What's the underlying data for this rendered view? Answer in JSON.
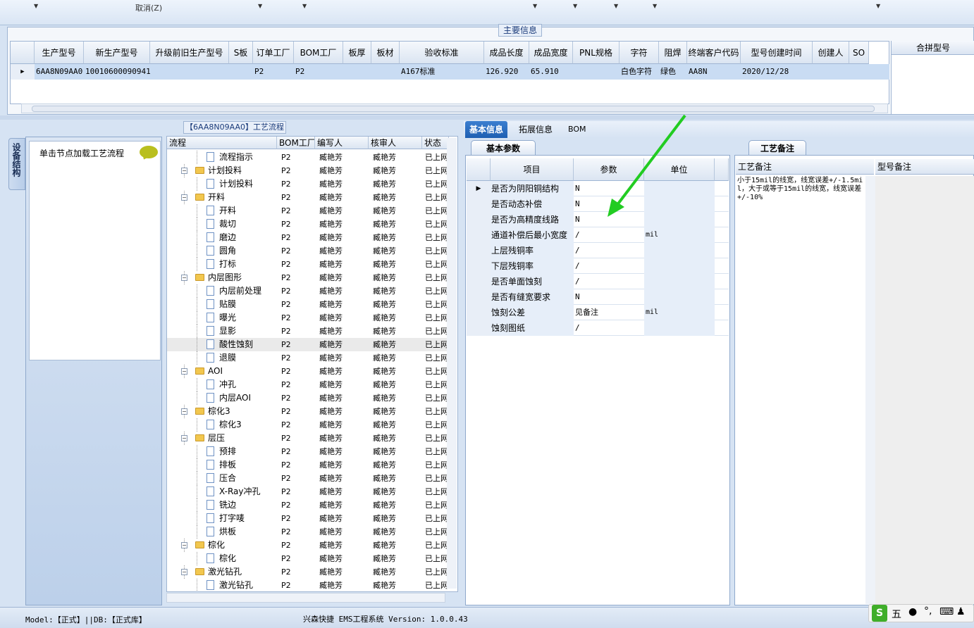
{
  "toolbar": {
    "cancel_label": "取消(Z)"
  },
  "main_info": {
    "title": "主要信息",
    "columns": [
      "生产型号",
      "新生产型号",
      "升级前旧生产型号",
      "S板",
      "订单工厂",
      "BOM工厂",
      "板厚",
      "板材",
      "验收标准",
      "成品长度",
      "成品宽度",
      "PNL规格",
      "字符",
      "阻焊",
      "终端客户代码",
      "型号创建时间",
      "创建人",
      "SO"
    ],
    "row": [
      "6AA8N09AA0",
      "10010600090941",
      "",
      "",
      "P2",
      "P2",
      "",
      "",
      "A167标准",
      "126.920",
      "65.910",
      "",
      "白色字符",
      "绿色",
      "AA8N",
      "2020/12/28",
      "",
      ""
    ],
    "merge_header": "合拼型号"
  },
  "left": {
    "vtab_label": "设备结构",
    "node_hint": "单击节点加载工艺流程"
  },
  "process": {
    "title": "【6AA8N09AA0】工艺流程",
    "columns": [
      "流程",
      "BOM工厂",
      "编写人",
      "核审人",
      "状态"
    ],
    "rows": [
      {
        "name": "流程指示",
        "type": "doc",
        "factory": "P2",
        "writer": "臧艳芳",
        "reviewer": "臧艳芳",
        "status": "已上网"
      },
      {
        "name": "计划投料",
        "type": "folder",
        "factory": "P2",
        "writer": "臧艳芳",
        "reviewer": "臧艳芳",
        "status": "已上网"
      },
      {
        "name": "计划投料",
        "type": "doc",
        "factory": "P2",
        "writer": "臧艳芳",
        "reviewer": "臧艳芳",
        "status": "已上网"
      },
      {
        "name": "开料",
        "type": "folder",
        "factory": "P2",
        "writer": "臧艳芳",
        "reviewer": "臧艳芳",
        "status": "已上网"
      },
      {
        "name": "开料",
        "type": "doc",
        "factory": "P2",
        "writer": "臧艳芳",
        "reviewer": "臧艳芳",
        "status": "已上网"
      },
      {
        "name": "裁切",
        "type": "doc",
        "factory": "P2",
        "writer": "臧艳芳",
        "reviewer": "臧艳芳",
        "status": "已上网"
      },
      {
        "name": "磨边",
        "type": "doc",
        "factory": "P2",
        "writer": "臧艳芳",
        "reviewer": "臧艳芳",
        "status": "已上网"
      },
      {
        "name": "圆角",
        "type": "doc",
        "factory": "P2",
        "writer": "臧艳芳",
        "reviewer": "臧艳芳",
        "status": "已上网"
      },
      {
        "name": "打标",
        "type": "doc",
        "factory": "P2",
        "writer": "臧艳芳",
        "reviewer": "臧艳芳",
        "status": "已上网"
      },
      {
        "name": "内层图形",
        "type": "folder",
        "factory": "P2",
        "writer": "臧艳芳",
        "reviewer": "臧艳芳",
        "status": "已上网"
      },
      {
        "name": "内层前处理",
        "type": "doc",
        "factory": "P2",
        "writer": "臧艳芳",
        "reviewer": "臧艳芳",
        "status": "已上网"
      },
      {
        "name": "贴膜",
        "type": "doc",
        "factory": "P2",
        "writer": "臧艳芳",
        "reviewer": "臧艳芳",
        "status": "已上网"
      },
      {
        "name": "曝光",
        "type": "doc",
        "factory": "P2",
        "writer": "臧艳芳",
        "reviewer": "臧艳芳",
        "status": "已上网"
      },
      {
        "name": "显影",
        "type": "doc",
        "factory": "P2",
        "writer": "臧艳芳",
        "reviewer": "臧艳芳",
        "status": "已上网"
      },
      {
        "name": "酸性蚀刻",
        "type": "doc",
        "factory": "P2",
        "writer": "臧艳芳",
        "reviewer": "臧艳芳",
        "status": "已上网",
        "selected": true
      },
      {
        "name": "退膜",
        "type": "doc",
        "factory": "P2",
        "writer": "臧艳芳",
        "reviewer": "臧艳芳",
        "status": "已上网"
      },
      {
        "name": "AOI",
        "type": "folder",
        "factory": "P2",
        "writer": "臧艳芳",
        "reviewer": "臧艳芳",
        "status": "已上网"
      },
      {
        "name": "冲孔",
        "type": "doc",
        "factory": "P2",
        "writer": "臧艳芳",
        "reviewer": "臧艳芳",
        "status": "已上网"
      },
      {
        "name": "内层AOI",
        "type": "doc",
        "factory": "P2",
        "writer": "臧艳芳",
        "reviewer": "臧艳芳",
        "status": "已上网"
      },
      {
        "name": "棕化3",
        "type": "folder",
        "factory": "P2",
        "writer": "臧艳芳",
        "reviewer": "臧艳芳",
        "status": "已上网"
      },
      {
        "name": "棕化3",
        "type": "doc",
        "factory": "P2",
        "writer": "臧艳芳",
        "reviewer": "臧艳芳",
        "status": "已上网"
      },
      {
        "name": "层压",
        "type": "folder",
        "factory": "P2",
        "writer": "臧艳芳",
        "reviewer": "臧艳芳",
        "status": "已上网"
      },
      {
        "name": "预排",
        "type": "doc",
        "factory": "P2",
        "writer": "臧艳芳",
        "reviewer": "臧艳芳",
        "status": "已上网"
      },
      {
        "name": "排板",
        "type": "doc",
        "factory": "P2",
        "writer": "臧艳芳",
        "reviewer": "臧艳芳",
        "status": "已上网"
      },
      {
        "name": "压合",
        "type": "doc",
        "factory": "P2",
        "writer": "臧艳芳",
        "reviewer": "臧艳芳",
        "status": "已上网"
      },
      {
        "name": "X-Ray冲孔",
        "type": "doc",
        "factory": "P2",
        "writer": "臧艳芳",
        "reviewer": "臧艳芳",
        "status": "已上网"
      },
      {
        "name": "铣边",
        "type": "doc",
        "factory": "P2",
        "writer": "臧艳芳",
        "reviewer": "臧艳芳",
        "status": "已上网"
      },
      {
        "name": "打字唛",
        "type": "doc",
        "factory": "P2",
        "writer": "臧艳芳",
        "reviewer": "臧艳芳",
        "status": "已上网"
      },
      {
        "name": "烘板",
        "type": "doc",
        "factory": "P2",
        "writer": "臧艳芳",
        "reviewer": "臧艳芳",
        "status": "已上网"
      },
      {
        "name": "棕化",
        "type": "folder",
        "factory": "P2",
        "writer": "臧艳芳",
        "reviewer": "臧艳芳",
        "status": "已上网"
      },
      {
        "name": "棕化",
        "type": "doc",
        "factory": "P2",
        "writer": "臧艳芳",
        "reviewer": "臧艳芳",
        "status": "已上网"
      },
      {
        "name": "激光钻孔",
        "type": "folder",
        "factory": "P2",
        "writer": "臧艳芳",
        "reviewer": "臧艳芳",
        "status": "已上网"
      },
      {
        "name": "激光钻孔",
        "type": "doc",
        "factory": "P2",
        "writer": "臧艳芳",
        "reviewer": "臧艳芳",
        "status": "已上网"
      }
    ]
  },
  "tabs": {
    "basic": "基本信息",
    "extended": "拓展信息",
    "bom": "BOM"
  },
  "params": {
    "tab": "基本参数",
    "columns": [
      "项目",
      "参数",
      "单位"
    ],
    "rows": [
      {
        "item": "是否为阴阳铜结构",
        "value": "N",
        "unit": ""
      },
      {
        "item": "是否动态补偿",
        "value": "N",
        "unit": ""
      },
      {
        "item": "是否为高精度线路",
        "value": "N",
        "unit": ""
      },
      {
        "item": "通道补偿后最小宽度",
        "value": "/",
        "unit": "mil"
      },
      {
        "item": "上层残铜率",
        "value": "/",
        "unit": ""
      },
      {
        "item": "下层残铜率",
        "value": "/",
        "unit": ""
      },
      {
        "item": "是否单面蚀刻",
        "value": "/",
        "unit": ""
      },
      {
        "item": "是否有缝宽要求",
        "value": "N",
        "unit": ""
      },
      {
        "item": "蚀刻公差",
        "value": "见备注",
        "unit": "mil"
      },
      {
        "item": "蚀刻图纸",
        "value": "/",
        "unit": ""
      }
    ]
  },
  "remarks": {
    "tab": "工艺备注",
    "col1": "工艺备注",
    "col2": "型号备注",
    "text": "小于15mil的线宽，线宽误差+/-1.5mil，大于或等于15mil的线宽，线宽误差+/-10%"
  },
  "status": {
    "model": "Model:【正式】||DB:【正式库】",
    "app": "兴森快捷 EMS工程系统 Version: 1.0.0.43"
  },
  "ime": {
    "mode": "五"
  },
  "colors": {
    "accent": "#1e5fb2",
    "selected_row": "#c9dcf3",
    "arrow": "#22cc22"
  }
}
